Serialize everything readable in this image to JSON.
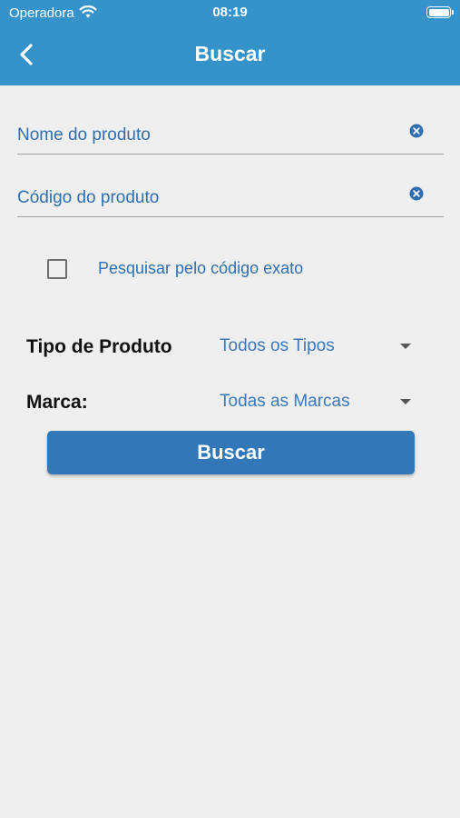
{
  "status_bar": {
    "carrier": "Operadora",
    "time": "08:19",
    "wifi_icon": "wifi-icon",
    "battery_icon": "battery-icon"
  },
  "header": {
    "title": "Buscar",
    "back_icon": "chevron-left-icon",
    "color": "#3693c9"
  },
  "form": {
    "product_name": {
      "placeholder": "Nome do produto",
      "value": ""
    },
    "product_code": {
      "placeholder": "Código do produto",
      "value": ""
    },
    "clear_icon": "clear-circle-icon",
    "exact_code_checkbox": {
      "label": "Pesquisar pelo código exato",
      "checked": false
    },
    "product_type": {
      "label": "Tipo de Produto",
      "selected": "Todos os Tipos"
    },
    "brand": {
      "label": "Marca:",
      "selected": "Todas as Marcas"
    },
    "search_button": "Buscar"
  },
  "colors": {
    "accent": "#2f6fb1",
    "button": "#3278b8",
    "background": "#efefef"
  }
}
